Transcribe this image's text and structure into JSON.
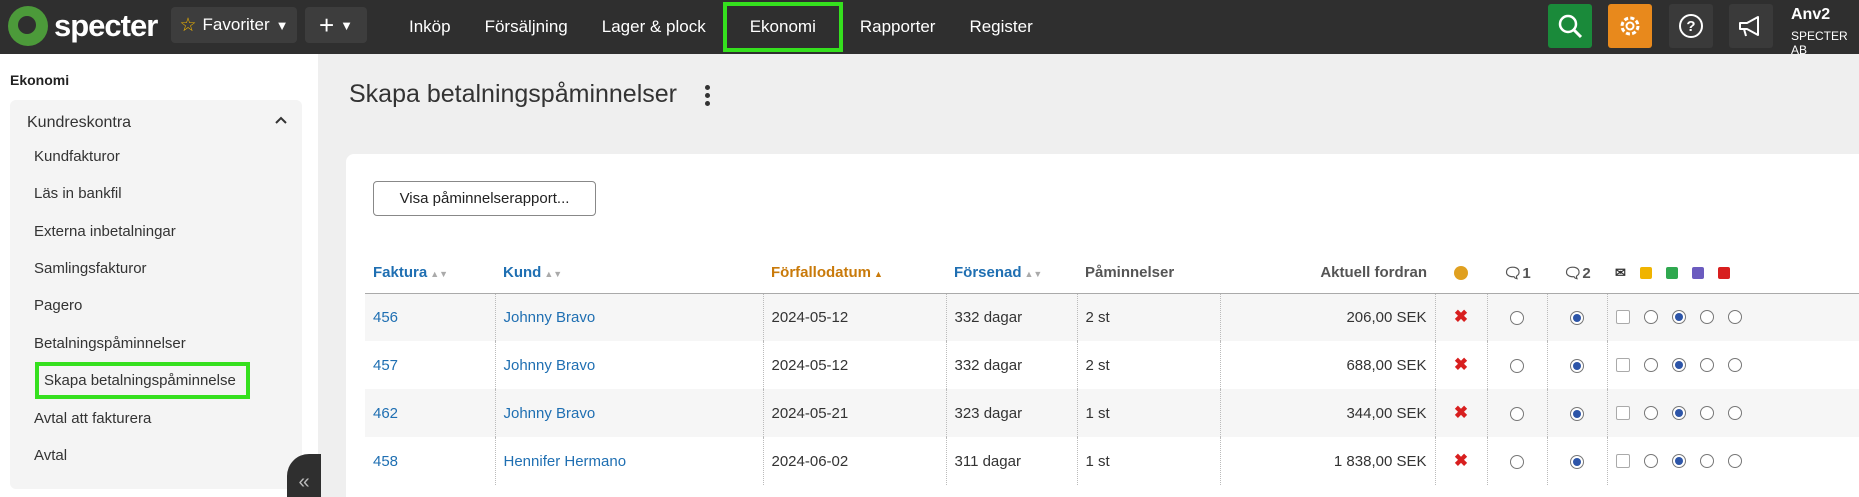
{
  "app": {
    "logo_text": "specter"
  },
  "topbar": {
    "favorites_label": "Favoriter",
    "nav": [
      "Inköp",
      "Försäljning",
      "Lager & plock",
      "Ekonomi",
      "Rapporter",
      "Register"
    ],
    "active_nav": "Ekonomi",
    "user_name": "Anv2",
    "user_org": "SPECTER AB",
    "icons": [
      "search-icon",
      "gear-icon",
      "help-icon",
      "megaphone-icon"
    ],
    "colors": {
      "search": "#1a8a3a",
      "gear": "#e8891c",
      "highlight": "#35e01e"
    }
  },
  "sidebar": {
    "section_title": "Ekonomi",
    "group_title": "Kundreskontra",
    "items": [
      "Kundfakturor",
      "Läs in bankfil",
      "Externa inbetalningar",
      "Samlingsfakturor",
      "Pagero",
      "Betalningspåminnelser",
      "Skapa betalningspåminnelse",
      "Avtal att fakturera",
      "Avtal"
    ],
    "active_item": "Skapa betalningspåminnelse"
  },
  "main": {
    "title": "Skapa betalningspåminnelser",
    "report_button": "Visa påminnelserapport...",
    "columns": {
      "faktura": "Faktura",
      "kund": "Kund",
      "forfallodatum": "Förfallodatum",
      "forsenad": "Försenad",
      "paminnelser": "Påminnelser",
      "fordran": "Aktuell fordran",
      "r1": "1",
      "r2": "2"
    },
    "rows": [
      {
        "faktura": "456",
        "kund": "Johnny Bravo",
        "datum": "2024-05-12",
        "forsenad": "332 dagar",
        "paminnelser": "2 st",
        "fordran": "206,00 SEK"
      },
      {
        "faktura": "457",
        "kund": "Johnny Bravo",
        "datum": "2024-05-12",
        "forsenad": "332 dagar",
        "paminnelser": "2 st",
        "fordran": "688,00 SEK"
      },
      {
        "faktura": "462",
        "kund": "Johnny Bravo",
        "datum": "2024-05-21",
        "forsenad": "323 dagar",
        "paminnelser": "1 st",
        "fordran": "344,00 SEK"
      },
      {
        "faktura": "458",
        "kund": "Hennifer Hermano",
        "datum": "2024-06-02",
        "forsenad": "311 dagar",
        "paminnelser": "1 st",
        "fordran": "1 838,00 SEK"
      }
    ]
  }
}
